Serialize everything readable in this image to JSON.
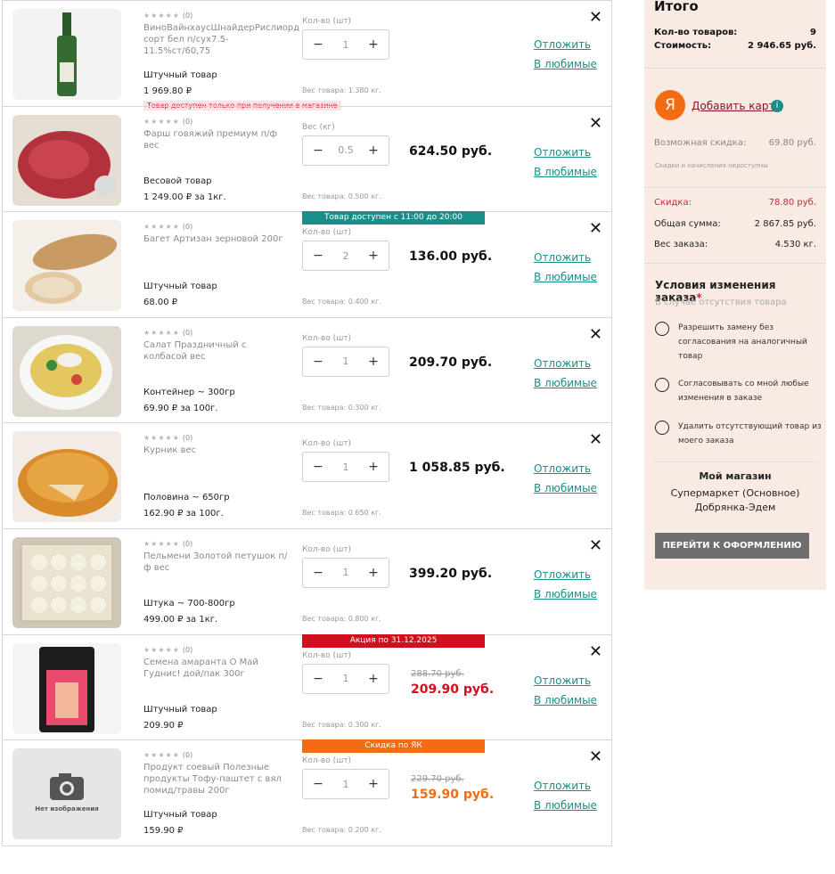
{
  "cart": {
    "items": [
      {
        "rating": "★★★★★",
        "reviews": "(0)",
        "name": "ВиноВайнхаусШнайдерРислиорд сорт бел п/сух7.5-11.5%ст/60,75",
        "type": "Штучный товар",
        "unit_price": "1 969.80 ₽",
        "qty_label": "Кол-во (шт)",
        "qty": "1",
        "weight": "Вес товара: 1.380 кг.",
        "badge": "Товар доступен только при получении в магазине",
        "total": "",
        "postpone": "Отложить",
        "favorite": "В любимые"
      },
      {
        "rating": "★★★★★",
        "reviews": "(0)",
        "name": "Фарш говяжий премиум п/ф вес",
        "type": "Весовой товар",
        "unit_price": "1 249.00 ₽ за 1кг.",
        "qty_label": "Вес (кг)",
        "qty": "0.5",
        "weight": "Вес товара: 0.500 кг.",
        "total": "624.50 руб.",
        "postpone": "Отложить",
        "favorite": "В любимые"
      },
      {
        "rating": "★★★★★",
        "reviews": "(0)",
        "name": "Багет Артизан зерновой 200г",
        "type": "Штучный товар",
        "unit_price": "68.00 ₽",
        "qty_label": "Кол-во (шт)",
        "qty": "2",
        "weight": "Вес товара: 0.400 кг.",
        "banner": "Товар доступен с 11:00 до 20:00",
        "total": "136.00 руб.",
        "postpone": "Отложить",
        "favorite": "В любимые"
      },
      {
        "rating": "★★★★★",
        "reviews": "(0)",
        "name": "Салат Праздничный с колбасой вес",
        "type": "Контейнер ~ 300гр",
        "unit_price": "69.90 ₽ за 100г.",
        "qty_label": "Кол-во (шт)",
        "qty": "1",
        "weight": "Вес товара: 0.300 кг.",
        "total": "209.70 руб.",
        "postpone": "Отложить",
        "favorite": "В любимые"
      },
      {
        "rating": "★★★★★",
        "reviews": "(0)",
        "name": "Курник вес",
        "type": "Половина ~ 650гр",
        "unit_price": "162.90 ₽ за 100г.",
        "qty_label": "Кол-во (шт)",
        "qty": "1",
        "weight": "Вес товара: 0.650 кг.",
        "total": "1 058.85 руб.",
        "postpone": "Отложить",
        "favorite": "В любимые"
      },
      {
        "rating": "★★★★★",
        "reviews": "(0)",
        "name": "Пельмени Золотой петушок п/ф вес",
        "type": "Штука ~ 700-800гр",
        "unit_price": "499.00 ₽ за 1кг.",
        "qty_label": "Кол-во (шт)",
        "qty": "1",
        "weight": "Вес товара: 0.800 кг.",
        "total": "399.20 руб.",
        "postpone": "Отложить",
        "favorite": "В любимые"
      },
      {
        "rating": "★★★★★",
        "reviews": "(0)",
        "name": "Семена амаранта О Май Гуднис! дой/пак 300г",
        "type": "Штучный товар",
        "unit_price": "209.90 ₽",
        "qty_label": "Кол-во (шт)",
        "qty": "1",
        "weight": "Вес товара: 0.300 кг.",
        "banner": "Акция по  31.12.2025",
        "old_price": "288.70  руб.",
        "new_price": "209.90  руб.",
        "postpone": "Отложить",
        "favorite": "В любимые"
      },
      {
        "rating": "★★★★★",
        "reviews": "(0)",
        "name": "Продукт соевый Полезные продукты Тофу-паштет с вял помид/травы 200г",
        "type": "Штучный товар",
        "unit_price": "159.90 ₽",
        "qty_label": "Кол-во (шт)",
        "qty": "1",
        "weight": "Вес товара: 0.200 кг.",
        "banner": "Скидка по ЯК",
        "old_price": "229.70  руб.",
        "new_price": "159.90  руб.",
        "no_image": "Нет изображения",
        "postpone": "Отложить",
        "favorite": "В любимые"
      }
    ]
  },
  "summary": {
    "title": "Итого",
    "items_count_label": "Кол-во товаров:",
    "items_count": "9",
    "cost_label": "Стоимость:",
    "cost": "2 946.65 руб.",
    "ya_letter": "Я",
    "add_card": "Добавить карту",
    "info_glyph": "i",
    "possible_discount_label": "Возможная скидка:",
    "possible_discount": "69.80 руб.",
    "discount_note": "Скидки и начисления недоступны",
    "discount_label": "Скидка:",
    "discount": "78.80 руб.",
    "total_label": "Общая сумма:",
    "total": "2 867.85 руб.",
    "weight_label": "Вес заказа:",
    "weight": "4.530 кг.",
    "conditions_title": "Условия изменения заказа",
    "conditions_star": "*",
    "conditions_sub": "В случае отсутствия товара",
    "options": [
      "Разрешить замену без согласования на аналогичный товар",
      "Согласовывать со мной любые изменения в заказе",
      "Удалить отсутствующий товар из моего заказа"
    ],
    "store_title": "Мой магазин",
    "store_name": "Супермаркет (Основное) Добрянка-Эдем",
    "checkout": "ПЕРЕЙТИ К ОФОРМЛЕНИЮ"
  },
  "colors": {
    "accent": "#1a8f8a",
    "promo_red": "#d10f1f",
    "promo_orange": "#f36c12",
    "panel_bg": "#f9ebe4"
  }
}
